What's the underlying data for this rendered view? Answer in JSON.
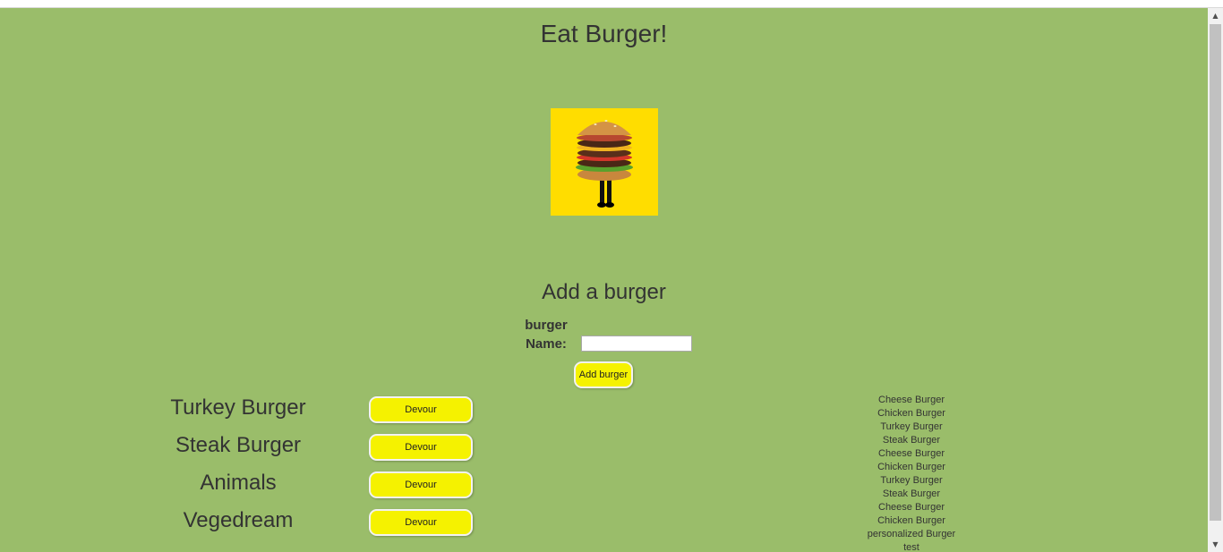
{
  "header": {
    "title": "Eat Burger!"
  },
  "hero": {
    "image_alt": "burger-with-legs"
  },
  "form": {
    "heading": "Add a burger",
    "name_label_line1": "burger",
    "name_label_line2": "Name:",
    "name_value": "",
    "submit_label": "Add burger"
  },
  "undevoured": [
    {
      "name": "Turkey Burger",
      "button": "Devour"
    },
    {
      "name": "Steak Burger",
      "button": "Devour"
    },
    {
      "name": "Animals",
      "button": "Devour"
    },
    {
      "name": "Vegedream",
      "button": "Devour"
    }
  ],
  "devoured": [
    "Cheese Burger",
    "Chicken Burger",
    "Turkey Burger",
    "Steak Burger",
    "Cheese Burger",
    "Chicken Burger",
    "Turkey Burger",
    "Steak Burger",
    "Cheese Burger",
    "Chicken Burger",
    "personalized Burger",
    "test"
  ],
  "colors": {
    "page_background": "#9abd6a",
    "button_background": "#f5f200",
    "hero_background": "#ffdd00",
    "text": "#333333"
  },
  "icons": {
    "scroll_up": "scroll-up-arrow-icon",
    "scroll_down": "scroll-down-arrow-icon"
  }
}
